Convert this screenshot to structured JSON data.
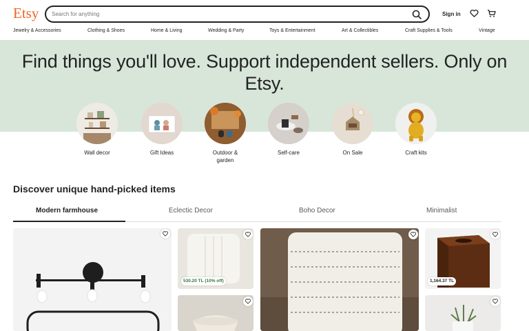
{
  "header": {
    "logo": "Etsy",
    "search_placeholder": "Search for anything",
    "signin_label": "Sign in",
    "icons": [
      "search-icon",
      "heart-icon",
      "cart-icon"
    ]
  },
  "categories": [
    "Jewelry & Accessories",
    "Clothing & Shoes",
    "Home & Living",
    "Wedding & Party",
    "Toys & Entertainment",
    "Art & Collectibles",
    "Craft Supplies & Tools",
    "Vintage"
  ],
  "hero": {
    "title": "Find things you'll love. Support independent sellers. Only on Etsy.",
    "background": "#d7e6d9"
  },
  "circles": [
    {
      "label": "Wall decor"
    },
    {
      "label": "Gift Ideas"
    },
    {
      "label": "Outdoor & garden"
    },
    {
      "label": "Self-care"
    },
    {
      "label": "On Sale"
    },
    {
      "label": "Craft kits"
    }
  ],
  "section": {
    "title": "Discover unique hand-picked items"
  },
  "tabs": [
    {
      "label": "Modern farmhouse",
      "active": true
    },
    {
      "label": "Eclectic Decor",
      "active": false
    },
    {
      "label": "Boho Decor",
      "active": false
    },
    {
      "label": "Minimalist",
      "active": false
    }
  ],
  "listings": [
    {
      "price": "",
      "discount": ""
    },
    {
      "price": "530.20 TL",
      "discount": "(10% off)"
    },
    {
      "price": "",
      "discount": ""
    },
    {
      "price": "",
      "discount": ""
    },
    {
      "price": "1,164.37 TL",
      "discount": ""
    },
    {
      "price": "",
      "discount": ""
    }
  ],
  "colors": {
    "brand": "#f1641e",
    "hero_bg": "#d7e6d9",
    "sale_green": "#2f7a3a"
  }
}
